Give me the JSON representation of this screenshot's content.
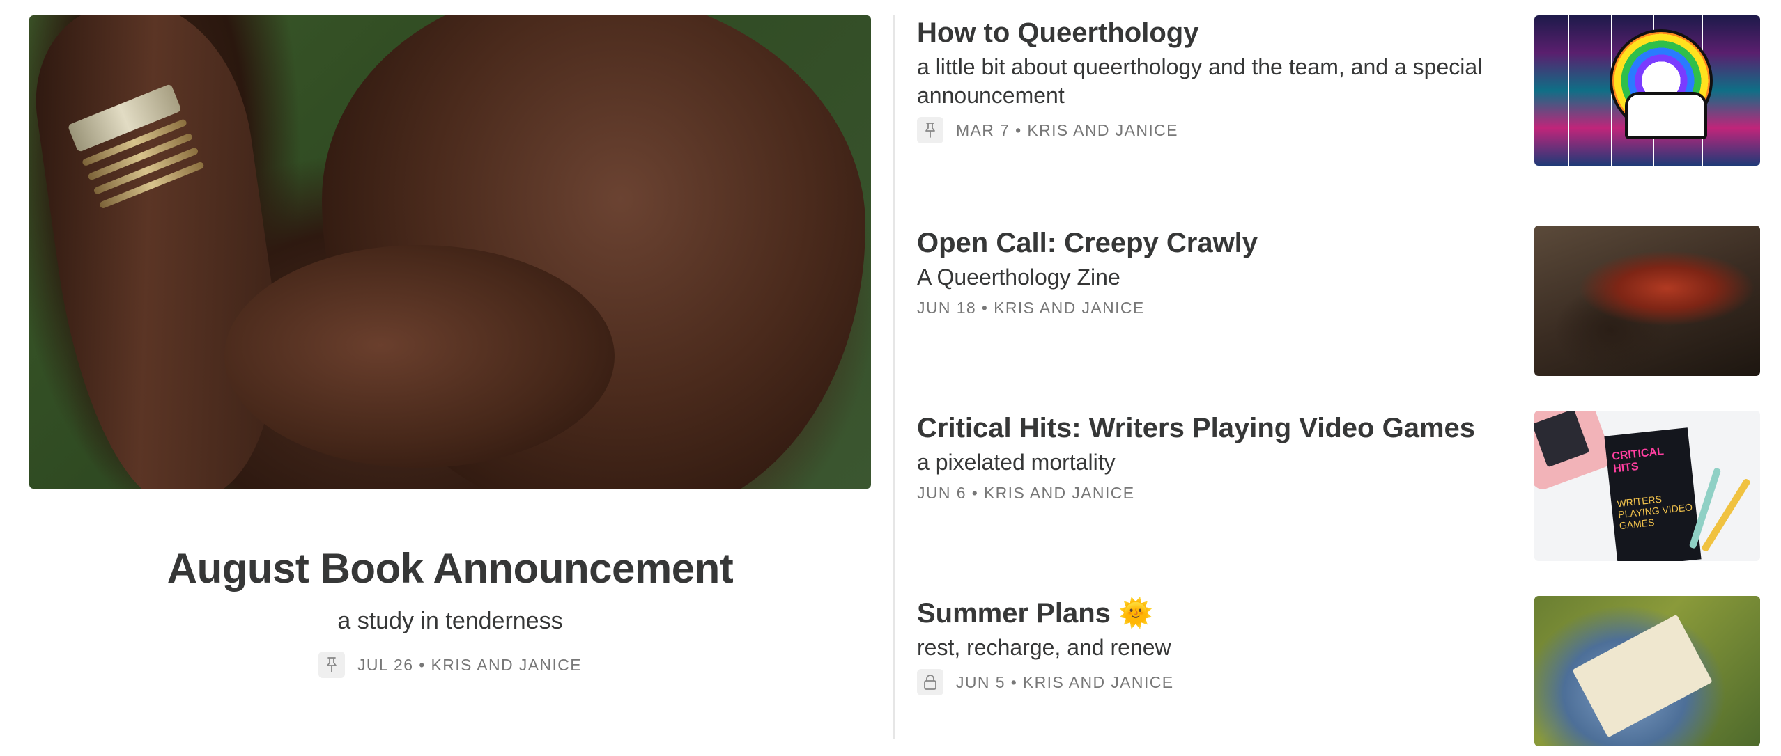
{
  "featured": {
    "title": "August Book Announcement",
    "subtitle": "a study in tenderness",
    "meta": "JUL 26 • KRIS AND JANICE",
    "icon": "pin-icon"
  },
  "posts": [
    {
      "title": "How to Queerthology",
      "subtitle": "a little bit about queerthology and the team, and a special announcement",
      "meta": "MAR 7 • KRIS AND JANICE",
      "icon": "pin-icon"
    },
    {
      "title": "Open Call: Creepy Crawly",
      "subtitle": "A Queerthology Zine",
      "meta": "JUN 18 • KRIS AND JANICE",
      "icon": ""
    },
    {
      "title": "Critical Hits: Writers Playing Video Games",
      "subtitle": "a pixelated mortality",
      "meta": "JUN 6 • KRIS AND JANICE",
      "icon": "",
      "thumb_text_1": "CRITICAL HITS",
      "thumb_text_2": "WRITERS PLAYING VIDEO GAMES"
    },
    {
      "title": "Summer Plans",
      "title_emoji": "🌞",
      "subtitle": "rest, recharge, and renew",
      "meta": "JUN 5 • KRIS AND JANICE",
      "icon": "lock-icon"
    }
  ]
}
